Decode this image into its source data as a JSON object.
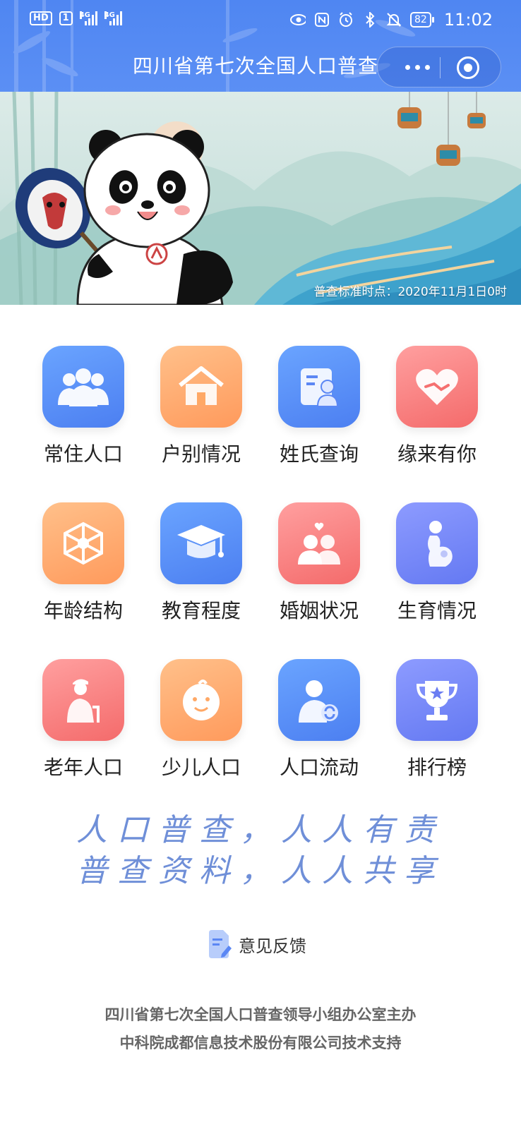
{
  "status_bar": {
    "hd": "HD",
    "sim": "1",
    "net1": "4G",
    "net2": "4G",
    "battery": "82",
    "time": "11:02",
    "icons": [
      "eye-icon",
      "nfc-icon",
      "alarm-icon",
      "bluetooth-icon",
      "mute-icon"
    ]
  },
  "header": {
    "title": "四川省第七次全国人口普查",
    "capsule_icons": [
      "more-icon",
      "close-target-icon"
    ]
  },
  "banner": {
    "caption": "普查标准时点：2020年11月1日0时"
  },
  "grid": {
    "items": [
      {
        "label": "常住人口",
        "icon": "people-group-icon",
        "color": "#5b87f4"
      },
      {
        "label": "户别情况",
        "icon": "house-icon",
        "color": "#ffa866"
      },
      {
        "label": "姓氏查询",
        "icon": "id-card-icon",
        "color": "#5b87f4"
      },
      {
        "label": "缘来有你",
        "icon": "heart-hands-icon",
        "color": "#f57070"
      },
      {
        "label": "年龄结构",
        "icon": "network-icon",
        "color": "#ffa866"
      },
      {
        "label": "教育程度",
        "icon": "graduation-cap-icon",
        "color": "#5b87f4"
      },
      {
        "label": "婚姻状况",
        "icon": "couple-icon",
        "color": "#f57070"
      },
      {
        "label": "生育情况",
        "icon": "pregnant-icon",
        "color": "#6b7df2"
      },
      {
        "label": "老年人口",
        "icon": "elderly-icon",
        "color": "#f57070"
      },
      {
        "label": "少儿人口",
        "icon": "baby-face-icon",
        "color": "#ffa866"
      },
      {
        "label": "人口流动",
        "icon": "person-sync-icon",
        "color": "#5b87f4"
      },
      {
        "label": "排行榜",
        "icon": "trophy-icon",
        "color": "#6b7df2"
      }
    ]
  },
  "slogan": {
    "line1": "人口普查，人人有责",
    "line2": "普查资料，人人共享"
  },
  "feedback": {
    "label": "意见反馈",
    "icon": "feedback-doc-icon"
  },
  "footer": {
    "line1": "四川省第七次全国人口普查领导小组办公室主办",
    "line2": "中科院成都信息技术股份有限公司技术支持"
  }
}
